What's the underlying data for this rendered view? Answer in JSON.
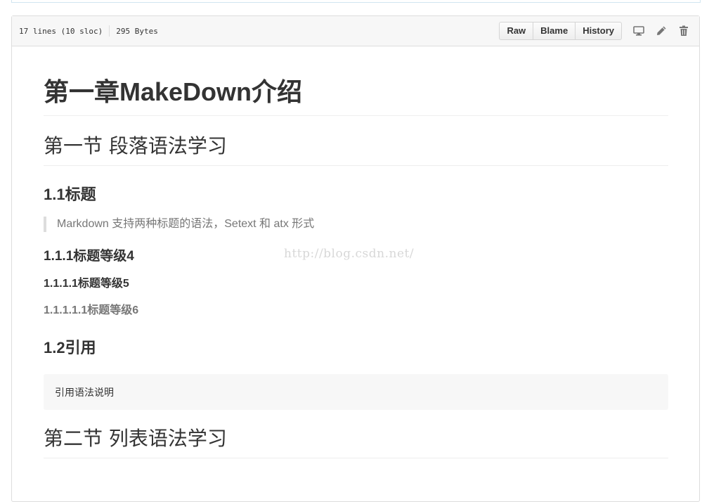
{
  "file_header": {
    "lines": "17 lines (10 sloc)",
    "size": "295 Bytes",
    "buttons": {
      "raw": "Raw",
      "blame": "Blame",
      "history": "History"
    },
    "icons": [
      "desktop-icon",
      "pencil-icon",
      "trash-icon"
    ]
  },
  "content": {
    "h1": "第一章MakeDown介绍",
    "section1": "第一节 段落语法学习",
    "h3_1": "1.1标题",
    "quote": "Markdown 支持两种标题的语法，Setext 和 atx 形式",
    "h4": "1.1.1标题等级4",
    "h5": "1.1.1.1标题等级5",
    "h6": "1.1.1.1.1标题等级6",
    "h3_2": "1.2引用",
    "code": "引用语法说明",
    "section2": "第二节 列表语法学习"
  },
  "watermark": "http://blog.csdn.net/",
  "colors": {
    "border": "#dddddd",
    "header_bg": "#f7f7f7",
    "muted": "#777777",
    "text": "#333333"
  }
}
